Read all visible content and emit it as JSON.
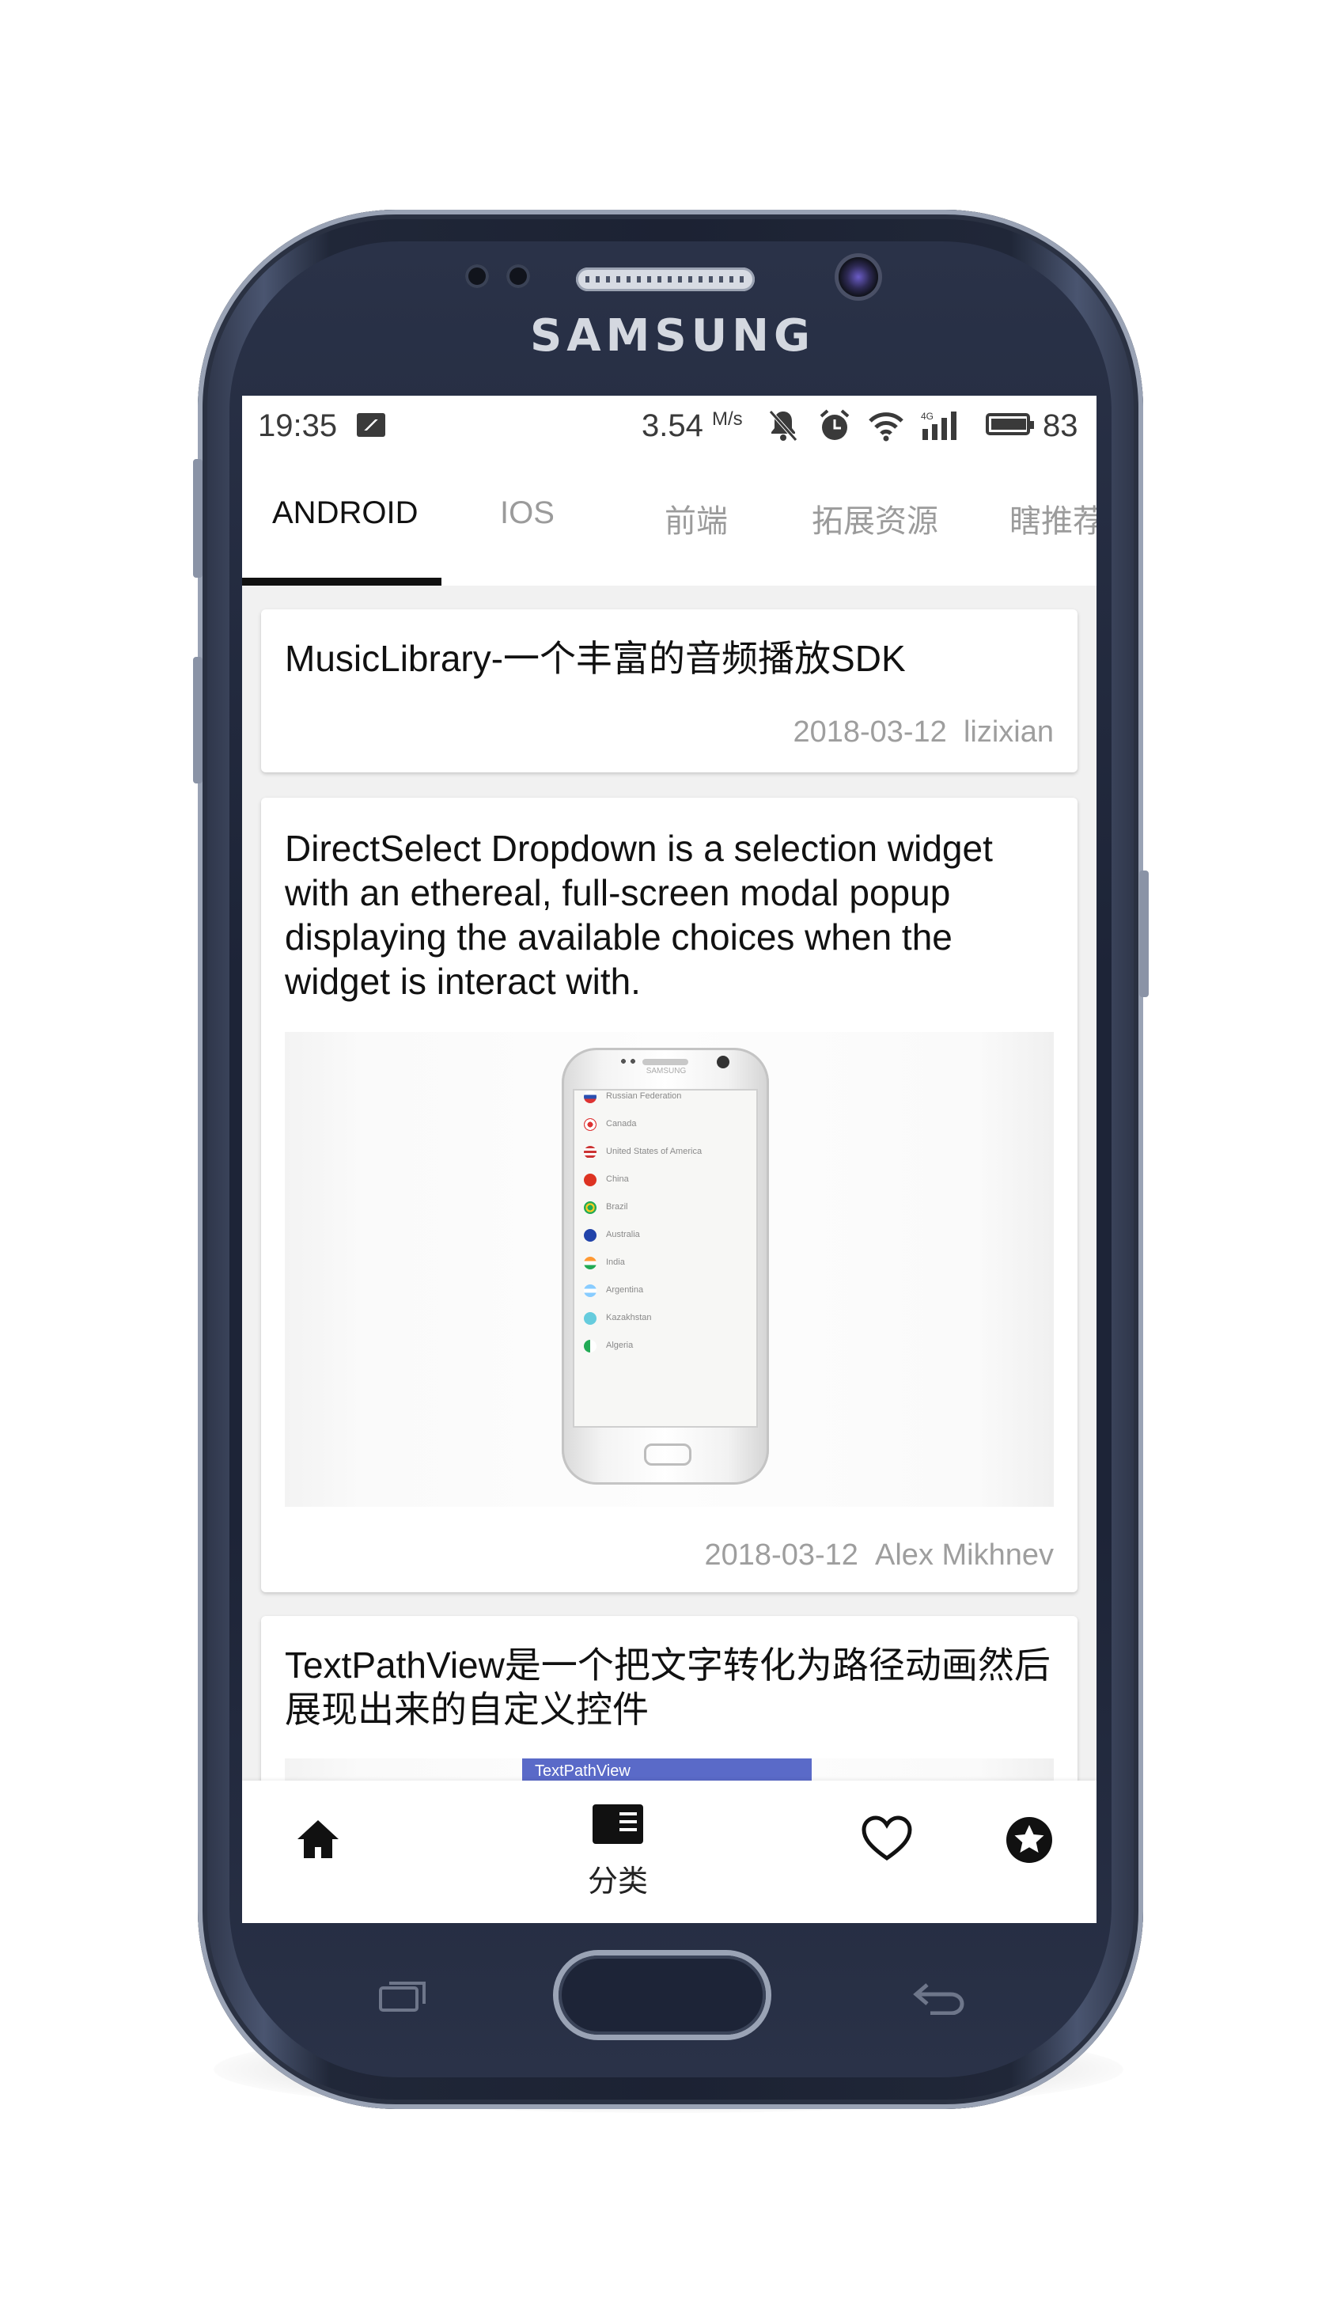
{
  "device": {
    "brand": "SAMSUNG"
  },
  "status_bar": {
    "time": "19:35",
    "speed": "3.54",
    "speed_unit": "M/s",
    "network": "4G",
    "battery": "83"
  },
  "tabs": [
    {
      "label": "ANDROID",
      "active": true
    },
    {
      "label": "IOS",
      "active": false
    },
    {
      "label": "前端",
      "active": false
    },
    {
      "label": "拓展资源",
      "active": false
    },
    {
      "label": "瞎推荐",
      "active": false
    }
  ],
  "feed": [
    {
      "title": "MusicLibrary-一个丰富的音频播放SDK",
      "date": "2018-03-12",
      "author": "lizixian"
    },
    {
      "title": "DirectSelect Dropdown is a selection widget with an ethereal, full-screen modal popup displaying the available choices when the widget is interact with.",
      "date": "2018-03-12",
      "author": "Alex Mikhnev",
      "image": {
        "phone_brand": "SAMSUNG",
        "countries": [
          "Russian Federation",
          "Canada",
          "United States of America",
          "China",
          "Brazil",
          "Australia",
          "India",
          "Argentina",
          "Kazakhstan",
          "Algeria"
        ]
      }
    },
    {
      "title": "TextPathView是一个把文字转化为路径动画然后展现出来的自定义控件",
      "image": {
        "banner_text": "TextPathView"
      }
    }
  ],
  "bottom_nav": [
    {
      "icon": "home-icon"
    },
    {
      "icon": "category-icon",
      "label": "分类"
    },
    {
      "icon": "heart-icon"
    },
    {
      "icon": "star-badge-icon"
    }
  ],
  "colors": {
    "tab_active": "#111111",
    "tab_inactive": "#9b9b9b",
    "meta": "#9e9e9e",
    "banner": "#5a6ac8"
  }
}
